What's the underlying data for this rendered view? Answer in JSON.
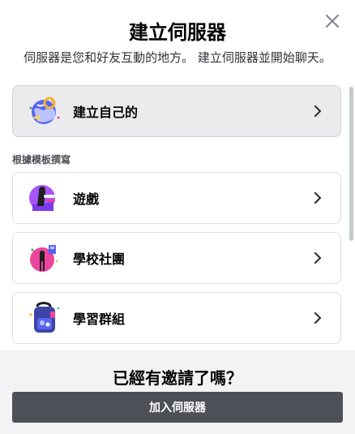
{
  "modal": {
    "title": "建立伺服器",
    "subtitle": "伺服器是您和好友互動的地方。 建立伺服器並開始聊天。",
    "close_icon": "close-icon"
  },
  "create_option": {
    "label": "建立自己的",
    "icon": "globe-icon"
  },
  "templates": {
    "section_label": "根據模板撰寫",
    "items": [
      {
        "label": "遊戲",
        "icon": "gaming-icon"
      },
      {
        "label": "學校社團",
        "icon": "school-club-icon"
      },
      {
        "label": "學習群組",
        "icon": "study-group-icon"
      }
    ]
  },
  "footer": {
    "title": "已經有邀請了嗎？",
    "join_button": "加入伺服器"
  },
  "colors": {
    "accent": "#4e5058",
    "footer_bg": "#f2f3f5",
    "border": "#dcdee1"
  }
}
